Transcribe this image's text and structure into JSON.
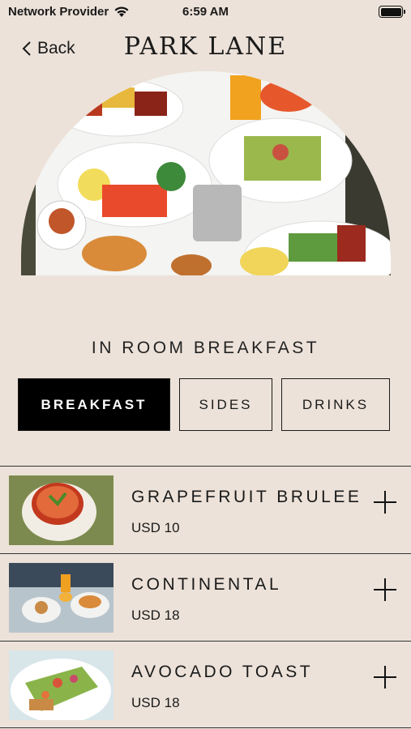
{
  "status_bar": {
    "carrier": "Network Provider",
    "time": "6:59 AM",
    "icons": [
      "wifi-icon",
      "battery-icon"
    ]
  },
  "nav": {
    "back_label": "Back",
    "brand": "PARK LANE"
  },
  "hero": {
    "image": "breakfast-table-photo"
  },
  "section_title": "IN ROOM BREAKFAST",
  "tabs": [
    {
      "label": "BREAKFAST",
      "active": true
    },
    {
      "label": "SIDES",
      "active": false
    },
    {
      "label": "DRINKS",
      "active": false
    }
  ],
  "menu": [
    {
      "name": "GRAPEFRUIT BRULEE",
      "price": "USD 10",
      "image": "grapefruit-photo"
    },
    {
      "name": "CONTINENTAL",
      "price": "USD 18",
      "image": "continental-photo"
    },
    {
      "name": "AVOCADO TOAST",
      "price": "USD 18",
      "image": "avocado-toast-photo"
    }
  ],
  "colors": {
    "background": "#ece2d9",
    "accent": "#000000",
    "text": "#1a1a1a"
  }
}
